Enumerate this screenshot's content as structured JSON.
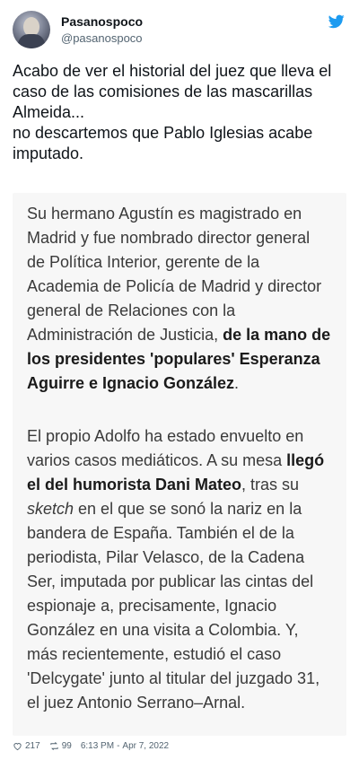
{
  "author": {
    "name": "Pasanospoco",
    "handle": "@pasanospoco"
  },
  "tweet": {
    "text": "Acabo de ver el historial del juez que lleva el caso de las comisiones de las mascarillas Almeida...\nno descartemos que Pablo Iglesias acabe imputado."
  },
  "image_text": {
    "p1_a": "Su hermano Agustín es magistrado en Madrid y fue nombrado director general de Política Interior, gerente de la Academia de Policía de Madrid y director general de Relaciones con la Administración de Justicia, ",
    "p1_bold": "de la mano de los presidentes 'populares' Esperanza Aguirre e Ignacio González",
    "p1_end": ".",
    "p2_a": "El propio Adolfo ha estado envuelto en varios casos mediáticos. A su mesa ",
    "p2_bold": "llegó el del humorista Dani Mateo",
    "p2_b": ", tras su ",
    "p2_italic": "sketch",
    "p2_c": " en el que se sonó la nariz en la bandera de España. También el de la periodista, Pilar Velasco, de la Cadena Ser, imputada por publicar las cintas del espionaje a, precisamente, Ignacio González en una visita a Colombia. Y, más recientemente, estudió el caso 'Delcygate' junto al titular del juzgado 31, el juez Antonio Serrano–Arnal."
  },
  "footer": {
    "likes": "217",
    "retweets": "99",
    "time": "6:13 PM",
    "separator": "-",
    "date": "Apr 7, 2022"
  },
  "colors": {
    "twitter_blue": "#1d9bf0",
    "secondary_text": "#536471"
  }
}
